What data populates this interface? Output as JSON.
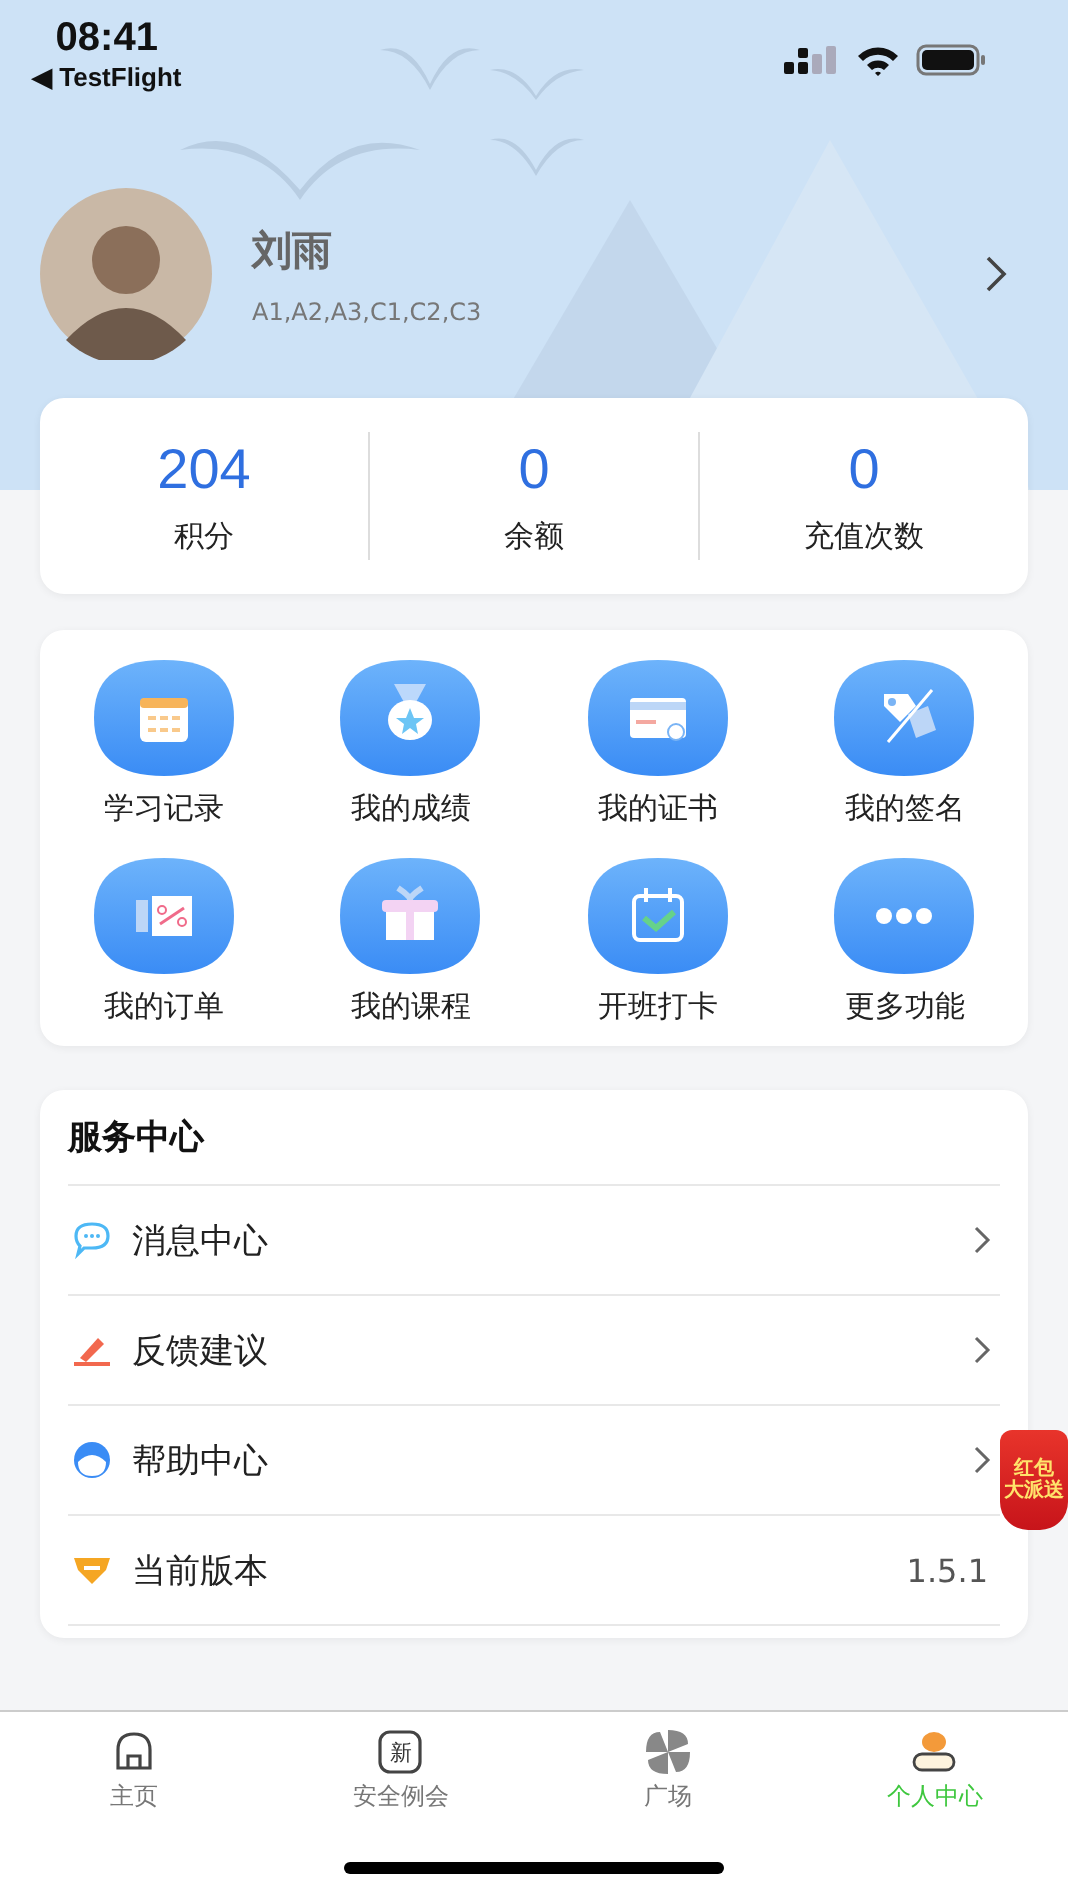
{
  "status_bar": {
    "time": "08:41",
    "back_app": "◀ TestFlight"
  },
  "profile": {
    "name": "刘雨",
    "licenses": "A1,A2,A3,C1,C2,C3"
  },
  "stats": [
    {
      "value": "204",
      "label": "积分"
    },
    {
      "value": "0",
      "label": "余额"
    },
    {
      "value": "0",
      "label": "充值次数"
    }
  ],
  "features": [
    {
      "kind": "calendar",
      "label": "学习记录"
    },
    {
      "kind": "medal",
      "label": "我的成绩"
    },
    {
      "kind": "certificate",
      "label": "我的证书"
    },
    {
      "kind": "signature",
      "label": "我的签名"
    },
    {
      "kind": "coupon",
      "label": "我的订单"
    },
    {
      "kind": "gift",
      "label": "我的课程"
    },
    {
      "kind": "checkin",
      "label": "开班打卡"
    },
    {
      "kind": "more",
      "label": "更多功能"
    }
  ],
  "service_center": {
    "title": "服务中心",
    "items": [
      {
        "kind": "message",
        "label": "消息中心",
        "chevron": true
      },
      {
        "kind": "feedback",
        "label": "反馈建议",
        "chevron": true
      },
      {
        "kind": "help",
        "label": "帮助中心",
        "chevron": true
      },
      {
        "kind": "version",
        "label": "当前版本",
        "value": "1.5.1",
        "chevron": false
      }
    ]
  },
  "promo_badge": {
    "line1": "红包",
    "line2": "大派送"
  },
  "tabs": [
    {
      "kind": "home",
      "label": "主页",
      "selected": false
    },
    {
      "kind": "news",
      "label": "安全例会",
      "icon_text": "新",
      "selected": false
    },
    {
      "kind": "pinwheel",
      "label": "广场",
      "selected": false
    },
    {
      "kind": "person",
      "label": "个人中心",
      "selected": true
    }
  ]
}
